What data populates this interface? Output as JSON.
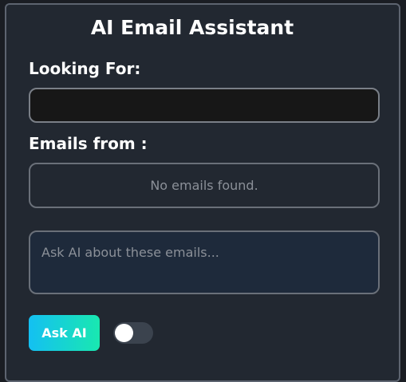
{
  "app": {
    "title": "AI Email Assistant"
  },
  "search": {
    "label": "Looking For:",
    "value": "",
    "placeholder": ""
  },
  "emails": {
    "label": "Emails from :",
    "empty_message": "No emails found."
  },
  "ask": {
    "placeholder": "Ask AI about these emails...",
    "value": "",
    "button_label": "Ask AI"
  },
  "toggle": {
    "state": "off"
  },
  "colors": {
    "panel_bg": "#222831",
    "button_gradient_start": "#14c0f2",
    "button_gradient_end": "#19e8b0",
    "textarea_bg": "#1e2a3b",
    "input_bg": "#171717"
  }
}
